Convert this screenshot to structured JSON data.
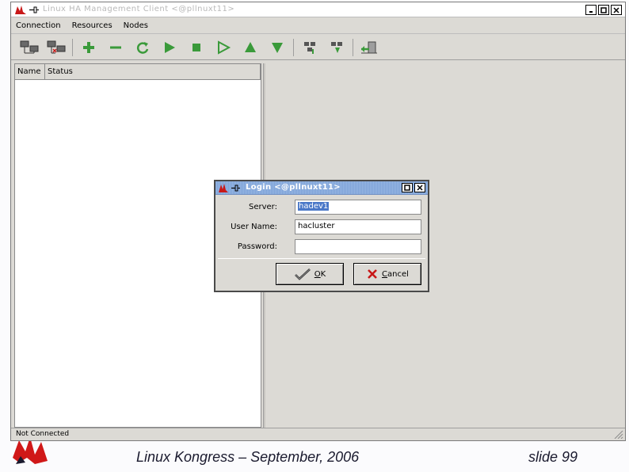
{
  "window": {
    "title": "Linux HA Management Client <@pllnuxt11>"
  },
  "menubar": {
    "items": [
      {
        "label": "Connection"
      },
      {
        "label": "Resources"
      },
      {
        "label": "Nodes"
      }
    ]
  },
  "toolbar": {
    "buttons": [
      {
        "icon": "connect-icon"
      },
      {
        "icon": "disconnect-icon"
      },
      {
        "icon": "add-icon"
      },
      {
        "icon": "remove-icon"
      },
      {
        "icon": "refresh-icon"
      },
      {
        "icon": "start-icon"
      },
      {
        "icon": "stop-icon"
      },
      {
        "icon": "default-icon"
      },
      {
        "icon": "move-up-icon"
      },
      {
        "icon": "move-down-icon"
      },
      {
        "icon": "standby-icon"
      },
      {
        "icon": "active-icon"
      },
      {
        "icon": "exit-icon"
      }
    ]
  },
  "tree": {
    "columns": [
      {
        "label": "Name"
      },
      {
        "label": "Status"
      }
    ]
  },
  "statusbar": {
    "text": "Not Connected"
  },
  "dialog": {
    "title": "Login <@pllnuxt11>",
    "fields": {
      "server": {
        "label": "Server:",
        "value": "hadev1"
      },
      "username": {
        "label": "User Name:",
        "value": "hacluster"
      },
      "password": {
        "label": "Password:",
        "value": ""
      }
    },
    "ok": {
      "accel": "O",
      "rest": "K"
    },
    "cancel": {
      "accel": "C",
      "rest": "ancel"
    }
  },
  "slide": {
    "footer": "Linux Kongress – September, 2006",
    "number": "slide 99"
  },
  "colors": {
    "window_bg": "#dcdad5",
    "dialog_title": "#7fa3d8",
    "toolbar_icon_green": "#3a9a3a",
    "slide_logo_red": "#d01818"
  }
}
